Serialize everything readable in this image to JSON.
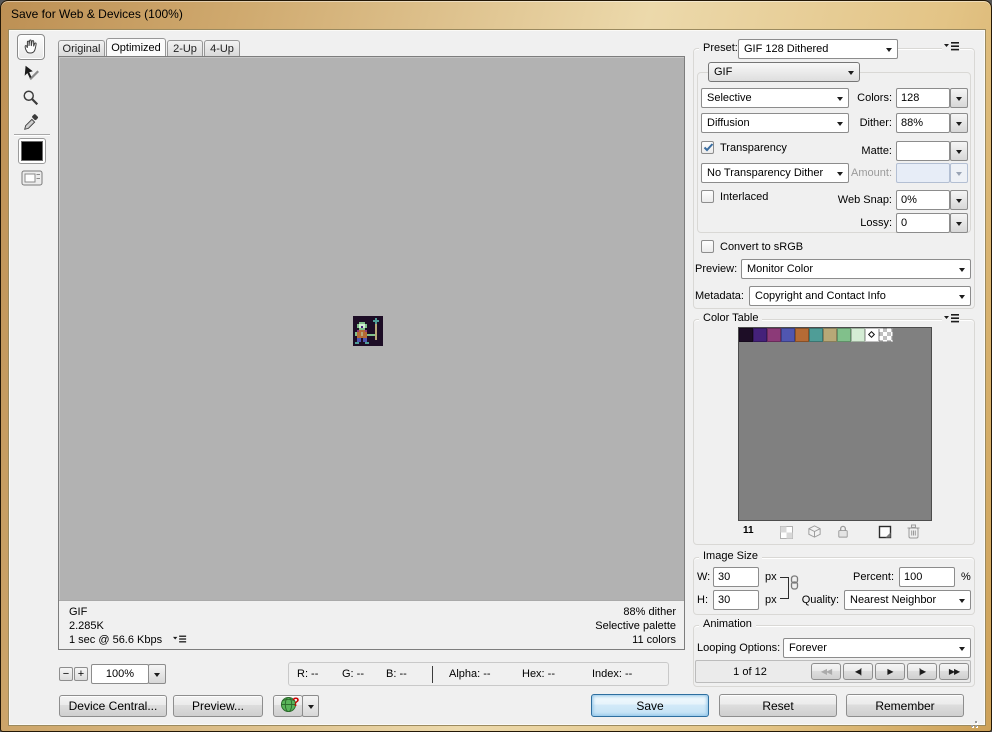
{
  "window": {
    "title": "Save for Web & Devices (100%)"
  },
  "tabs": [
    {
      "label": "Original"
    },
    {
      "label": "Optimized"
    },
    {
      "label": "2-Up"
    },
    {
      "label": "4-Up"
    }
  ],
  "tools": {
    "foreground_color": "#000000"
  },
  "preview": {
    "format": "GIF",
    "file_size": "2.285K",
    "download_time": "1 sec @ 56.6 Kbps",
    "dither_info": "88% dither",
    "palette_info": "Selective palette",
    "colors_info": "11 colors"
  },
  "sprite": {
    "palette": {
      ".": "#1d0d26",
      "P": "#44217a",
      "M": "#8c3a78",
      "B": "#5056b0",
      "O": "#b56b35",
      "T": "#4f9d97",
      "N": "#b8a877",
      "G": "#81c08b",
      "L": "#d4ecd4"
    },
    "rows": [
      "...............",
      "...........T...",
      "..........TTT..",
      "...GGG.....T...",
      "..GLLLG....N...",
      "..GLPLG....N...",
      "...GGG.....N...",
      "..MOOOM....N...",
      ".GOONOO....N...",
      ".GOONOOGGGGN...",
      "..OOOOO....N...",
      "..BB.BB....N...",
      "..BB.BB........",
      ".TT...TT.......",
      "..............."
    ]
  },
  "zoombar": {
    "minus": "−",
    "plus": "+",
    "zoom_level": "100%",
    "r": "R: --",
    "g": "G: --",
    "b": "B: --",
    "alpha": "Alpha: --",
    "hex": "Hex: --",
    "index": "Index: --"
  },
  "footer": {
    "device_central": "Device Central...",
    "preview": "Preview...",
    "save": "Save",
    "reset": "Reset",
    "remember": "Remember"
  },
  "settings": {
    "preset_label": "Preset:",
    "preset_value": "GIF 128 Dithered",
    "format_value": "GIF",
    "palette_value": "Selective",
    "colors_label": "Colors:",
    "colors_value": "128",
    "dither_method_value": "Diffusion",
    "dither_label": "Dither:",
    "dither_value": "88%",
    "transparency_label": "Transparency",
    "transparency_checked": true,
    "matte_label": "Matte:",
    "matte_value": "",
    "transparency_dither_value": "No Transparency Dither",
    "amount_label": "Amount:",
    "amount_value": "",
    "interlaced_label": "Interlaced",
    "interlaced_checked": false,
    "web_snap_label": "Web Snap:",
    "web_snap_value": "0%",
    "lossy_label": "Lossy:",
    "lossy_value": "0",
    "convert_srgb_label": "Convert to sRGB",
    "convert_srgb_checked": false,
    "preview_label": "Preview:",
    "preview_value": "Monitor Color",
    "metadata_label": "Metadata:",
    "metadata_value": "Copyright and Contact Info"
  },
  "color_table": {
    "title": "Color Table",
    "count": "11",
    "swatches": [
      {
        "hex": "#1d0d26"
      },
      {
        "hex": "#44217a"
      },
      {
        "hex": "#8c3a78"
      },
      {
        "hex": "#5056b0"
      },
      {
        "hex": "#b56b35"
      },
      {
        "hex": "#4f9d97"
      },
      {
        "hex": "#b8a877"
      },
      {
        "hex": "#81c08b"
      },
      {
        "hex": "#d4ecd4"
      },
      {
        "hex": "#ffffff",
        "marker": "diamond"
      },
      {
        "checker": true
      }
    ]
  },
  "image_size": {
    "title": "Image Size",
    "w_label": "W:",
    "w_value": "30",
    "h_label": "H:",
    "h_value": "30",
    "px_unit": "px",
    "percent_label": "Percent:",
    "percent_value": "100",
    "percent_unit": "%",
    "quality_label": "Quality:",
    "quality_value": "Nearest Neighbor"
  },
  "animation": {
    "title": "Animation",
    "looping_label": "Looping Options:",
    "looping_value": "Forever",
    "frame_counter": "1 of 12",
    "transport": [
      {
        "glyph": "◀◀",
        "disabled": true
      },
      {
        "glyph": "◀|",
        "disabled": false
      },
      {
        "glyph": "▶",
        "disabled": false
      },
      {
        "glyph": "|▶",
        "disabled": false
      },
      {
        "glyph": "▶▶",
        "disabled": false
      }
    ]
  }
}
